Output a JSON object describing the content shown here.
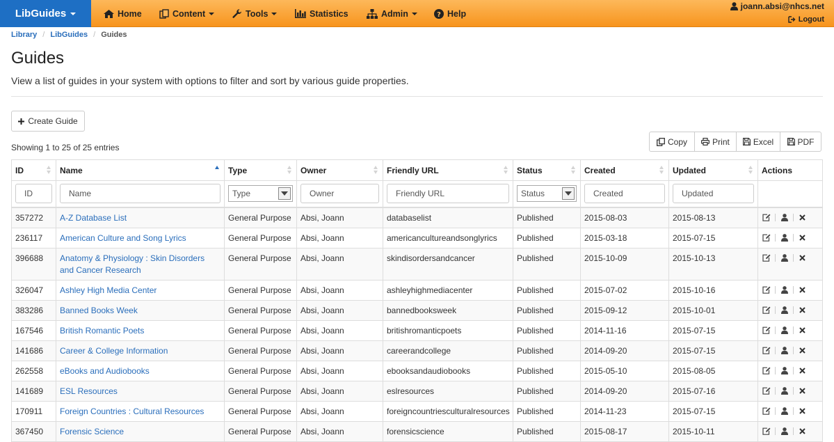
{
  "nav": {
    "brand": "LibGuides",
    "items": [
      {
        "label": "Home",
        "icon": "home-icon",
        "has_caret": false
      },
      {
        "label": "Content",
        "icon": "content-icon",
        "has_caret": true
      },
      {
        "label": "Tools",
        "icon": "wrench-icon",
        "has_caret": true
      },
      {
        "label": "Statistics",
        "icon": "bar-chart-icon",
        "has_caret": false
      },
      {
        "label": "Admin",
        "icon": "sitemap-icon",
        "has_caret": true
      },
      {
        "label": "Help",
        "icon": "question-icon",
        "has_caret": false
      }
    ],
    "user_email": "joann.absi@nhcs.net",
    "logout_label": "Logout"
  },
  "breadcrumb": [
    "Library",
    "LibGuides",
    "Guides"
  ],
  "page": {
    "title": "Guides",
    "description": "View a list of guides in your system with options to filter and sort by various guide properties.",
    "create_label": "Create Guide",
    "showing": "Showing 1 to 25 of 25 entries"
  },
  "export_buttons": [
    {
      "label": "Copy",
      "icon": "copy-icon"
    },
    {
      "label": "Print",
      "icon": "print-icon"
    },
    {
      "label": "Excel",
      "icon": "save-icon"
    },
    {
      "label": "PDF",
      "icon": "save-icon"
    }
  ],
  "table": {
    "columns": [
      "ID",
      "Name",
      "Type",
      "Owner",
      "Friendly URL",
      "Status",
      "Created",
      "Updated",
      "Actions"
    ],
    "filters": {
      "id": "ID",
      "name": "Name",
      "type": "Type",
      "owner": "Owner",
      "url": "Friendly URL",
      "status": "Status",
      "created": "Created",
      "updated": "Updated"
    },
    "rows": [
      {
        "id": "357272",
        "name": "A-Z Database List",
        "type": "General Purpose",
        "owner": "Absi, Joann",
        "url": "databaselist",
        "status": "Published",
        "created": "2015-08-03",
        "updated": "2015-08-13"
      },
      {
        "id": "236117",
        "name": "American Culture and Song Lyrics",
        "type": "General Purpose",
        "owner": "Absi, Joann",
        "url": "americancultureandsonglyrics",
        "status": "Published",
        "created": "2015-03-18",
        "updated": "2015-07-15"
      },
      {
        "id": "396688",
        "name": "Anatomy & Physiology : Skin Disorders and Cancer Research",
        "type": "General Purpose",
        "owner": "Absi, Joann",
        "url": "skindisordersandcancer",
        "status": "Published",
        "created": "2015-10-09",
        "updated": "2015-10-13"
      },
      {
        "id": "326047",
        "name": "Ashley High Media Center",
        "type": "General Purpose",
        "owner": "Absi, Joann",
        "url": "ashleyhighmediacenter",
        "status": "Published",
        "created": "2015-07-02",
        "updated": "2015-10-16"
      },
      {
        "id": "383286",
        "name": "Banned Books Week",
        "type": "General Purpose",
        "owner": "Absi, Joann",
        "url": "bannedbooksweek",
        "status": "Published",
        "created": "2015-09-12",
        "updated": "2015-10-01"
      },
      {
        "id": "167546",
        "name": "British Romantic Poets",
        "type": "General Purpose",
        "owner": "Absi, Joann",
        "url": "britishromanticpoets",
        "status": "Published",
        "created": "2014-11-16",
        "updated": "2015-07-15"
      },
      {
        "id": "141686",
        "name": "Career & College Information",
        "type": "General Purpose",
        "owner": "Absi, Joann",
        "url": "careerandcollege",
        "status": "Published",
        "created": "2014-09-20",
        "updated": "2015-07-15"
      },
      {
        "id": "262558",
        "name": "eBooks and Audiobooks",
        "type": "General Purpose",
        "owner": "Absi, Joann",
        "url": "ebooksandaudiobooks",
        "status": "Published",
        "created": "2015-05-10",
        "updated": "2015-08-05"
      },
      {
        "id": "141689",
        "name": "ESL Resources",
        "type": "General Purpose",
        "owner": "Absi, Joann",
        "url": "eslresources",
        "status": "Published",
        "created": "2014-09-20",
        "updated": "2015-07-16"
      },
      {
        "id": "170911",
        "name": "Foreign Countries : Cultural Resources",
        "type": "General Purpose",
        "owner": "Absi, Joann",
        "url": "foreigncountriesculturalresources",
        "status": "Published",
        "created": "2014-11-23",
        "updated": "2015-07-15"
      },
      {
        "id": "367450",
        "name": "Forensic Science",
        "type": "General Purpose",
        "owner": "Absi, Joann",
        "url": "forensicscience",
        "status": "Published",
        "created": "2015-08-17",
        "updated": "2015-10-11"
      }
    ],
    "row_actions": [
      "edit-icon",
      "user-icon",
      "delete-icon"
    ]
  },
  "colors": {
    "navbar": "#f7941d",
    "brand": "#1e6fc4",
    "link": "#2a6ebb"
  }
}
